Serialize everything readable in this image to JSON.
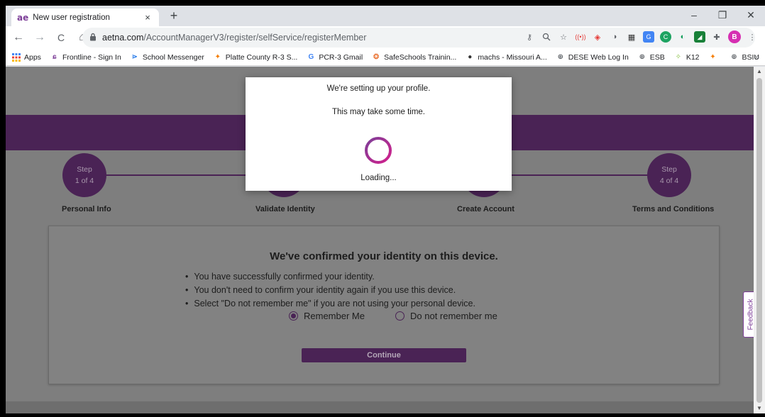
{
  "browser": {
    "tab_favicon": "ae",
    "tab_title": "New user registration",
    "tab_close": "×",
    "new_tab": "+",
    "window_controls": {
      "minimize": "–",
      "restore": "❐",
      "close": "✕"
    },
    "nav": {
      "back": "←",
      "forward": "→",
      "reload": "C",
      "home": "⌂"
    },
    "url_host": "aetna.com",
    "url_path": "/AccountManagerV3/register/selfService/registerMember",
    "profile_initial": "B",
    "extensions": [
      "key-icon",
      "zoom-icon",
      "star-icon",
      "ext-red-icon",
      "ext-red2-icon",
      "circle-icon",
      "qr-icon",
      "translate-icon",
      "green-circle-icon",
      "teal-icon",
      "green-ext-icon",
      "puzzle-icon"
    ]
  },
  "bookmarks": {
    "items": [
      {
        "label": "Apps",
        "icon": "apps-grid-icon",
        "color": "#4285f4"
      },
      {
        "label": "Frontline - Sign In",
        "icon": "frontline-icon",
        "color": "#7d3f98"
      },
      {
        "label": "School Messenger",
        "icon": "messenger-icon",
        "color": "#1a73e8"
      },
      {
        "label": "Platte County R-3 S...",
        "icon": "star-orange-icon",
        "color": "#f57c00"
      },
      {
        "label": "PCR-3 Gmail",
        "icon": "google-icon",
        "color": "#4285f4"
      },
      {
        "label": "SafeSchools Trainin...",
        "icon": "safeschools-icon",
        "color": "#e65100"
      },
      {
        "label": "machs - Missouri A...",
        "icon": "machs-icon",
        "color": "#333333"
      },
      {
        "label": "DESE Web Log In",
        "icon": "globe-icon",
        "color": "#5f6368"
      },
      {
        "label": "ESB",
        "icon": "globe-icon",
        "color": "#5f6368"
      },
      {
        "label": "K12",
        "icon": "k12-icon",
        "color": "#8bc34a"
      },
      {
        "label": "",
        "icon": "star-orange-icon",
        "color": "#f57c00"
      },
      {
        "label": "BSIU",
        "icon": "globe-icon",
        "color": "#5f6368"
      }
    ],
    "more": "»"
  },
  "stepper": {
    "steps": [
      {
        "circle_top": "Step",
        "circle_bottom": "1 of 4",
        "label": "Personal Info"
      },
      {
        "circle_top": "",
        "circle_bottom": "",
        "label": "Validate Identity"
      },
      {
        "circle_top": "",
        "circle_bottom": "",
        "label": "Create Account"
      },
      {
        "circle_top": "Step",
        "circle_bottom": "4 of 4",
        "label": "Terms and Conditions"
      }
    ]
  },
  "card": {
    "title": "We've confirmed your identity on this device.",
    "bullets": [
      "You have successfully confirmed your identity.",
      "You don't need to confirm your identity again if you use this device.",
      "Select \"Do not remember me\" if you are not using your personal device."
    ],
    "remember_label": "Remember Me",
    "dont_remember_label": "Do not remember me",
    "selected": "remember",
    "continue_label": "Continue"
  },
  "modal": {
    "line1": "We're setting up your profile.",
    "line2": "This may take some time.",
    "loading": "Loading..."
  },
  "feedback": "Feedback",
  "colors": {
    "brand_purple": "#4a2355",
    "aetna_purple": "#7d3f98",
    "spinner_pink": "#d21f8c"
  }
}
